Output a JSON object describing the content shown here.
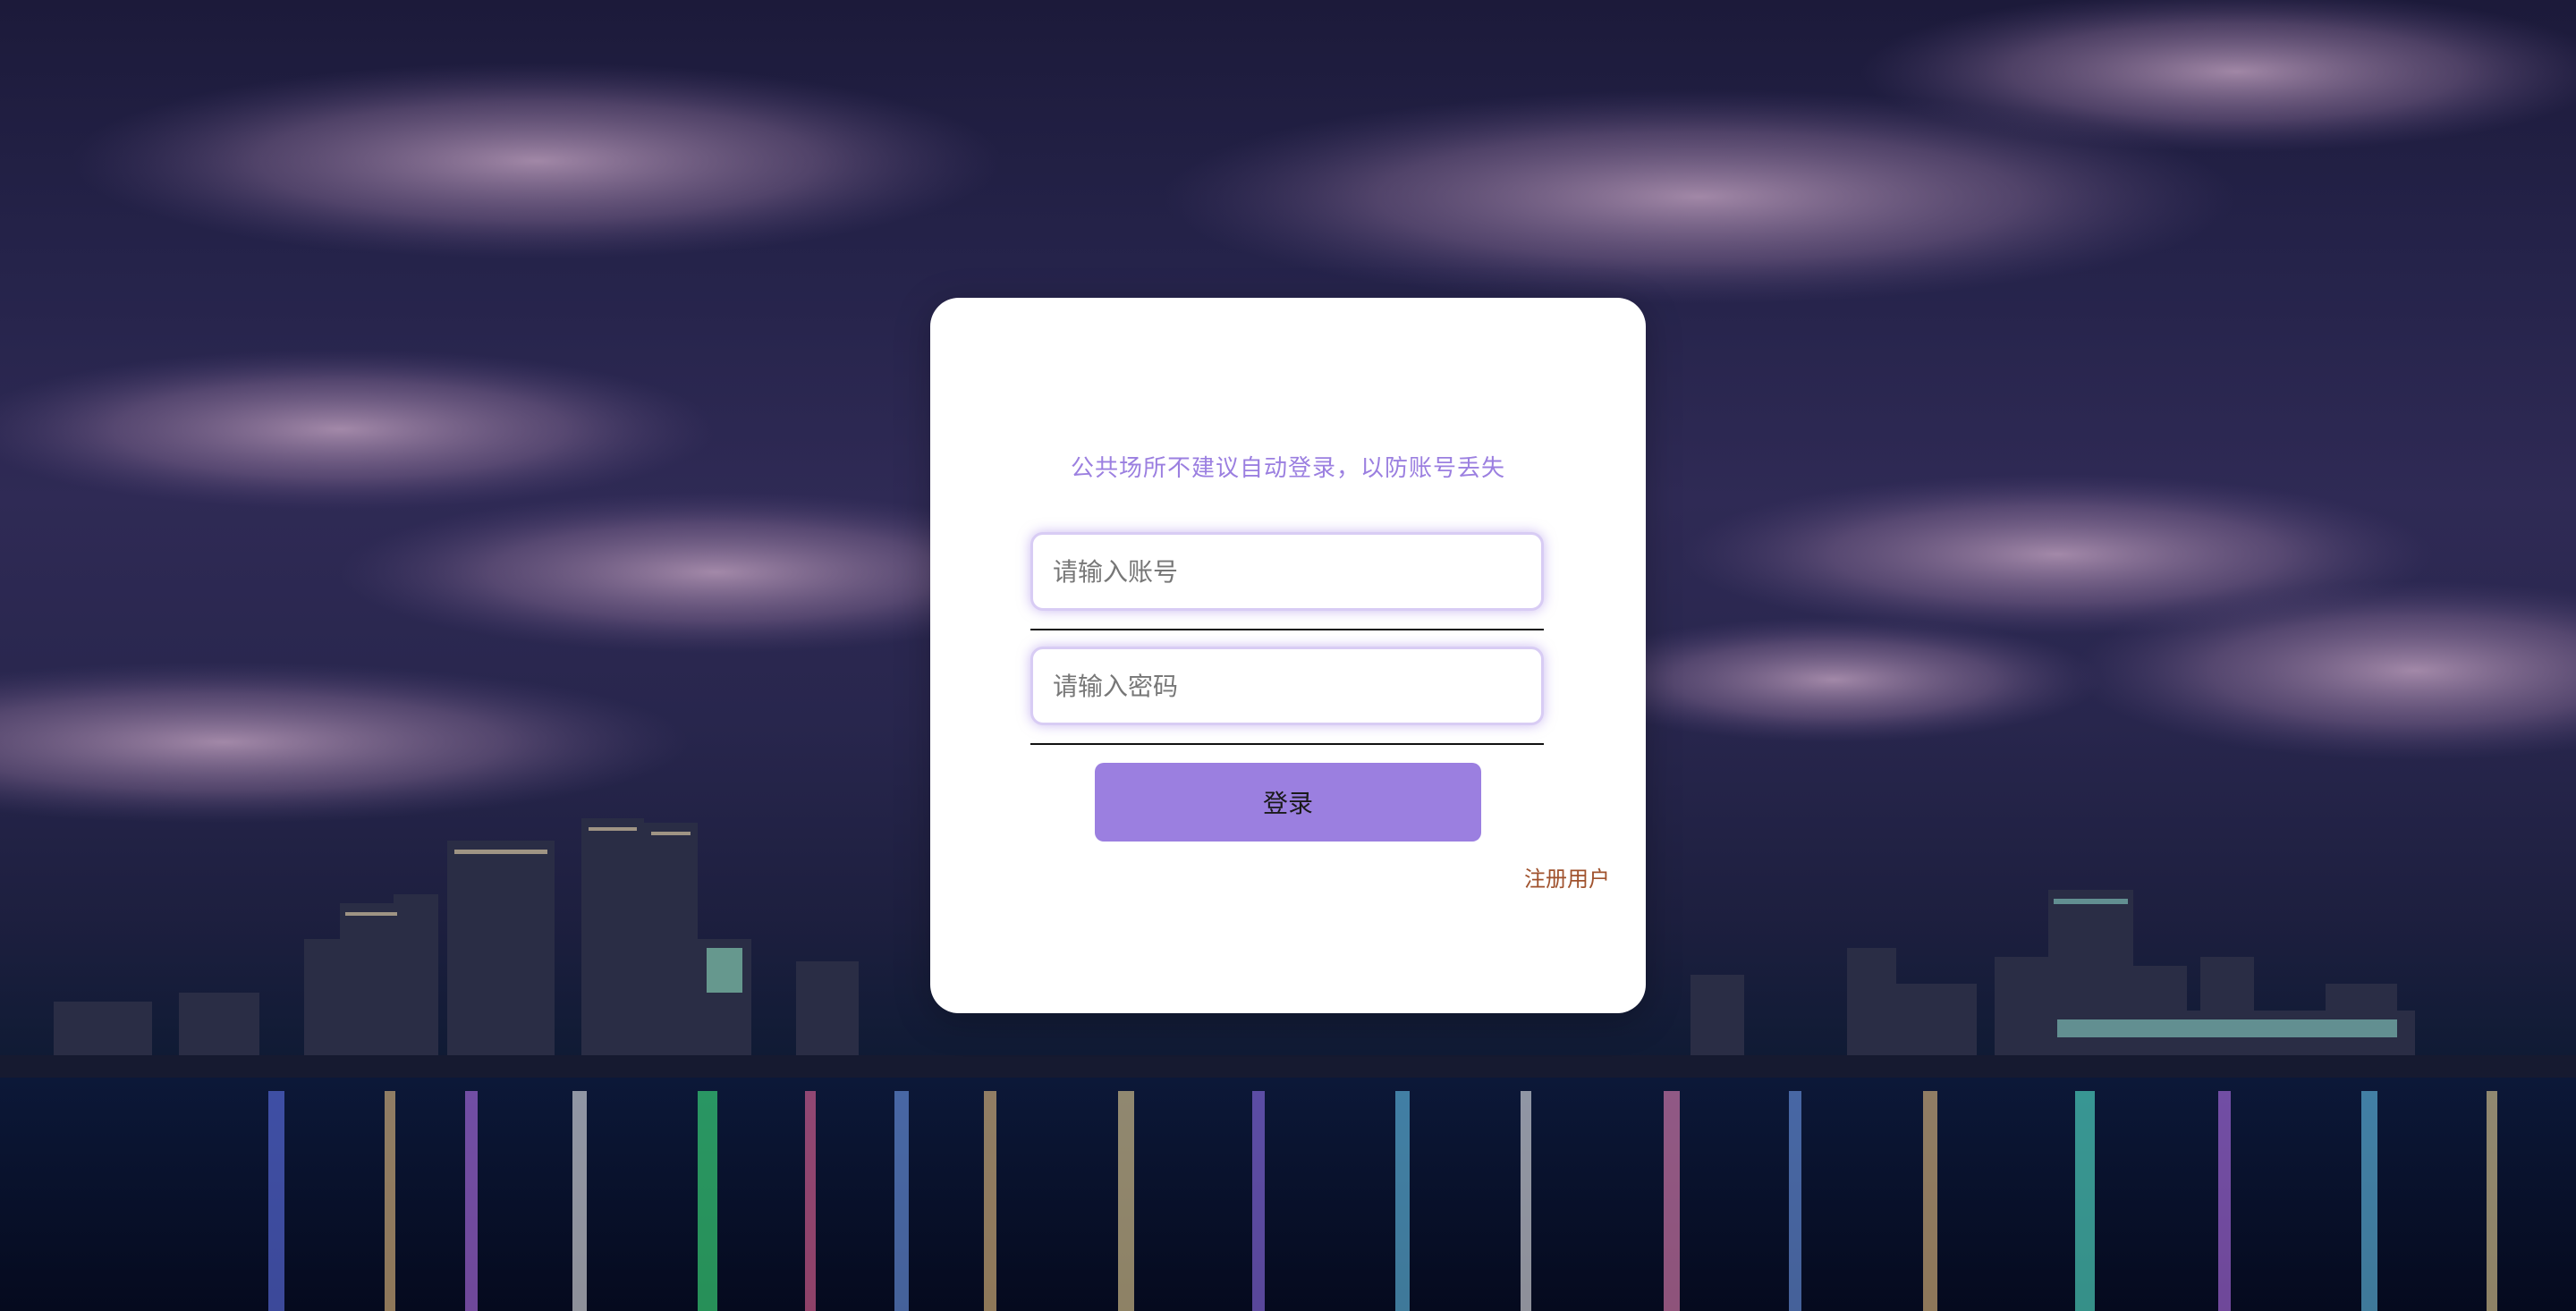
{
  "login": {
    "hint": "公共场所不建议自动登录，以防账号丢失",
    "account_placeholder": "请输入账号",
    "password_placeholder": "请输入密码",
    "login_label": "登录",
    "register_label": "注册用户"
  },
  "colors": {
    "accent": "#9b7fe0",
    "register_link": "#a0522d",
    "card_background": "#ffffff"
  }
}
